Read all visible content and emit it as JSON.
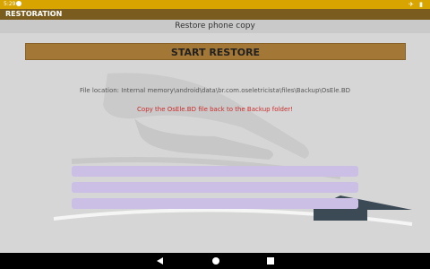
{
  "status_bar": {
    "time": "5:29",
    "right_icons": "✈ ▮"
  },
  "app_bar": {
    "title": "RESTORATION"
  },
  "screen": {
    "subtitle": "Restore phone copy",
    "start_button": "START RESTORE",
    "file_location": "File location: Internal memory\\android\\data\\br.com.oseletricista\\files\\Backup\\OsEle.BD",
    "hint": "Copy the OsEle.BD file back to the Backup folder!"
  },
  "colors": {
    "status_bar": "#d8a400",
    "app_bar": "#7a5d1e",
    "start_button": "#a37736",
    "hint_text": "#cc2b2b",
    "progress_bar": "#cbbfe6"
  }
}
